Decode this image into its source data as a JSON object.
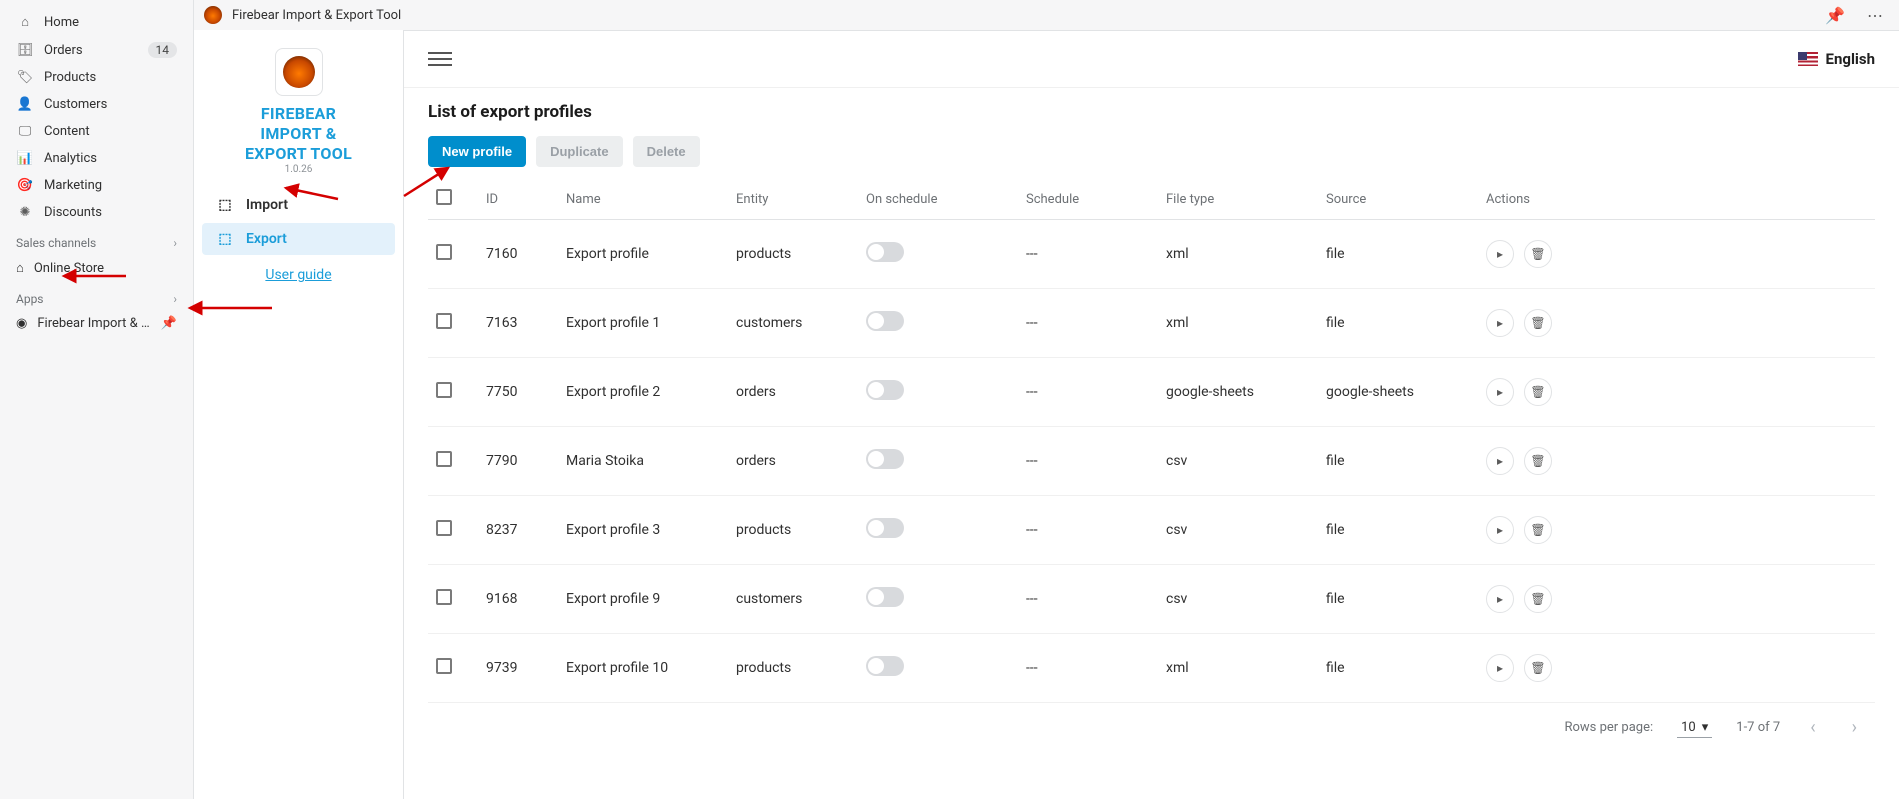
{
  "nav": {
    "items": [
      {
        "icon": "⌂",
        "label": "Home"
      },
      {
        "icon": "🗄",
        "label": "Orders",
        "badge": "14"
      },
      {
        "icon": "🏷",
        "label": "Products"
      },
      {
        "icon": "👤",
        "label": "Customers"
      },
      {
        "icon": "🖵",
        "label": "Content"
      },
      {
        "icon": "📊",
        "label": "Analytics"
      },
      {
        "icon": "🎯",
        "label": "Marketing"
      },
      {
        "icon": "✺",
        "label": "Discounts"
      }
    ],
    "section_sales": "Sales channels",
    "online_store": {
      "icon": "⌂",
      "label": "Online Store"
    },
    "section_apps": "Apps",
    "app": {
      "label": "Firebear Import & Exp..."
    }
  },
  "titlebar": {
    "app_name": "Firebear Import & Export Tool"
  },
  "appside": {
    "brand_line1": "FIREBEAR",
    "brand_line2": "IMPORT &",
    "brand_line3": "EXPORT TOOL",
    "version": "1.0.26",
    "import": "Import",
    "export": "Export",
    "guide": "User guide"
  },
  "header": {
    "language": "English"
  },
  "page": {
    "title": "List of export profiles",
    "btn_new": "New profile",
    "btn_dup": "Duplicate",
    "btn_del": "Delete"
  },
  "table": {
    "headers": {
      "id": "ID",
      "name": "Name",
      "entity": "Entity",
      "on_schedule": "On schedule",
      "schedule": "Schedule",
      "file_type": "File type",
      "source": "Source",
      "actions": "Actions"
    },
    "rows": [
      {
        "id": "7160",
        "name": "Export profile",
        "entity": "products",
        "schedule": "---",
        "file_type": "xml",
        "source": "file"
      },
      {
        "id": "7163",
        "name": "Export profile 1",
        "entity": "customers",
        "schedule": "---",
        "file_type": "xml",
        "source": "file"
      },
      {
        "id": "7750",
        "name": "Export profile 2",
        "entity": "orders",
        "schedule": "---",
        "file_type": "google-sheets",
        "source": "google-sheets"
      },
      {
        "id": "7790",
        "name": "Maria Stoika",
        "entity": "orders",
        "schedule": "---",
        "file_type": "csv",
        "source": "file"
      },
      {
        "id": "8237",
        "name": "Export profile 3",
        "entity": "products",
        "schedule": "---",
        "file_type": "csv",
        "source": "file"
      },
      {
        "id": "9168",
        "name": "Export profile 9",
        "entity": "customers",
        "schedule": "---",
        "file_type": "csv",
        "source": "file"
      },
      {
        "id": "9739",
        "name": "Export profile 10",
        "entity": "products",
        "schedule": "---",
        "file_type": "xml",
        "source": "file"
      }
    ]
  },
  "pager": {
    "rows_label": "Rows per page:",
    "rows_value": "10",
    "range": "1-7 of 7"
  }
}
